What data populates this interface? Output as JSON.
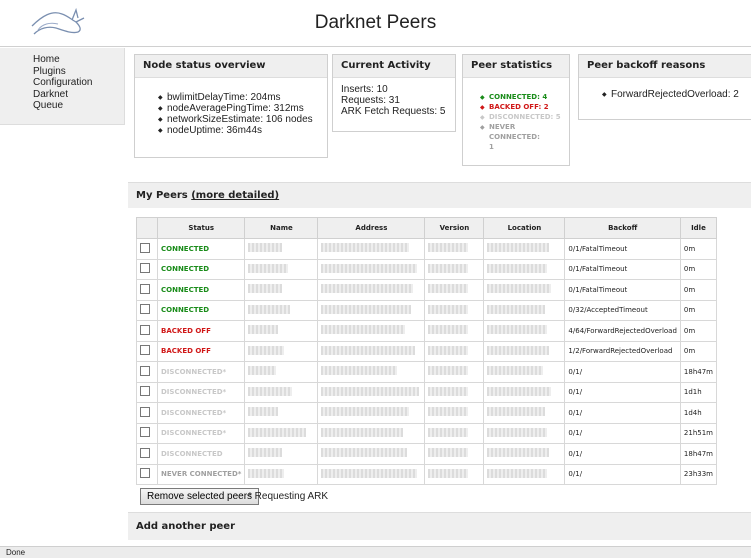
{
  "header": {
    "title": "Darknet Peers",
    "logo_icon": "rabbit-logo-icon"
  },
  "nav": {
    "items": [
      "Home",
      "Plugins",
      "Configuration",
      "Darknet",
      "Queue"
    ]
  },
  "node_status": {
    "title": "Node status overview",
    "items": [
      "bwlimitDelayTime: 204ms",
      "nodeAveragePingTime: 312ms",
      "networkSizeEstimate: 106 nodes",
      "nodeUptime: 36m44s"
    ]
  },
  "activity": {
    "title": "Current Activity",
    "lines": [
      "Inserts: 10",
      "Requests: 31",
      "ARK Fetch Requests: 5"
    ]
  },
  "peer_stats": {
    "title": "Peer statistics",
    "items": [
      "CONNECTED: 4",
      "BACKED OFF: 2",
      "DISCONNECTED: 5",
      "NEVER CONNECTED: 1"
    ]
  },
  "backoff_reasons": {
    "title": "Peer backoff reasons",
    "items": [
      "ForwardRejectedOverload: 2"
    ]
  },
  "peers": {
    "title": "My Peers",
    "link": "(more detailed)",
    "headers": [
      "Status",
      "Name",
      "Address",
      "Version",
      "Location",
      "Backoff",
      "Idle"
    ],
    "rows": [
      {
        "status": "CONNECTED",
        "backoff": "0/1/FatalTimeout",
        "idle": "0m"
      },
      {
        "status": "CONNECTED",
        "backoff": "0/1/FatalTimeout",
        "idle": "0m"
      },
      {
        "status": "CONNECTED",
        "backoff": "0/1/FatalTimeout",
        "idle": "0m"
      },
      {
        "status": "CONNECTED",
        "backoff": "0/32/AcceptedTimeout",
        "idle": "0m"
      },
      {
        "status": "BACKED OFF",
        "backoff": "4/64/ForwardRejectedOverload",
        "idle": "0m"
      },
      {
        "status": "BACKED OFF",
        "backoff": "1/2/ForwardRejectedOverload",
        "idle": "0m"
      },
      {
        "status": "DISCONNECTED*",
        "backoff": "0/1/",
        "idle": "18h47m"
      },
      {
        "status": "DISCONNECTED*",
        "backoff": "0/1/",
        "idle": "1d1h"
      },
      {
        "status": "DISCONNECTED*",
        "backoff": "0/1/",
        "idle": "1d4h"
      },
      {
        "status": "DISCONNECTED*",
        "backoff": "0/1/",
        "idle": "21h51m"
      },
      {
        "status": "DISCONNECTED",
        "backoff": "0/1/",
        "idle": "18h47m"
      },
      {
        "status": "NEVER CONNECTED*",
        "backoff": "0/1/",
        "idle": "23h33m"
      }
    ],
    "remove_button": "Remove selected peers",
    "requesting_note": "* Requesting ARK"
  },
  "add_peer": {
    "title": "Add another peer"
  },
  "statusbar": {
    "text": "Done"
  },
  "colors": {
    "connected": "#1a8c1a",
    "backed_off": "#d01818",
    "disconnected": "#c8c8c8",
    "never": "#a0a0a0",
    "panel": "#efefef"
  }
}
